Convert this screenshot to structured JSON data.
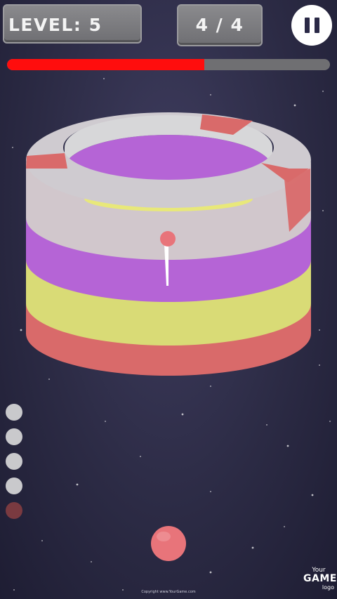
{
  "hud": {
    "level_label": "LEVEL: 5",
    "stage_counter": "4 / 4",
    "progress_fraction": 0.61
  },
  "pause_button": {
    "icon": "pause-icon"
  },
  "tower": {
    "ring_colors_top_to_bottom": [
      "#d1c7cc",
      "#b564d6",
      "#d9db76",
      "#d96a6a"
    ],
    "top_segment_red_color": "#d96a6a",
    "inner_colors": [
      "#d7d7d9",
      "#b564d6",
      "#e8e87a"
    ]
  },
  "projectile": {
    "color": "#e8747a"
  },
  "shooter_ball": {
    "color": "#e8747a"
  },
  "ammo_queue": [
    {
      "state": "remaining",
      "color": "#c9c9cc"
    },
    {
      "state": "remaining",
      "color": "#c9c9cc"
    },
    {
      "state": "remaining",
      "color": "#c9c9cc"
    },
    {
      "state": "remaining",
      "color": "#c9c9cc"
    },
    {
      "state": "current",
      "color": "#7a3a40"
    }
  ],
  "footer": {
    "copyright": "Copyright www.YourGame.com",
    "logo_your": "Your",
    "logo_game": "GAME",
    "logo_sub": "logo"
  }
}
